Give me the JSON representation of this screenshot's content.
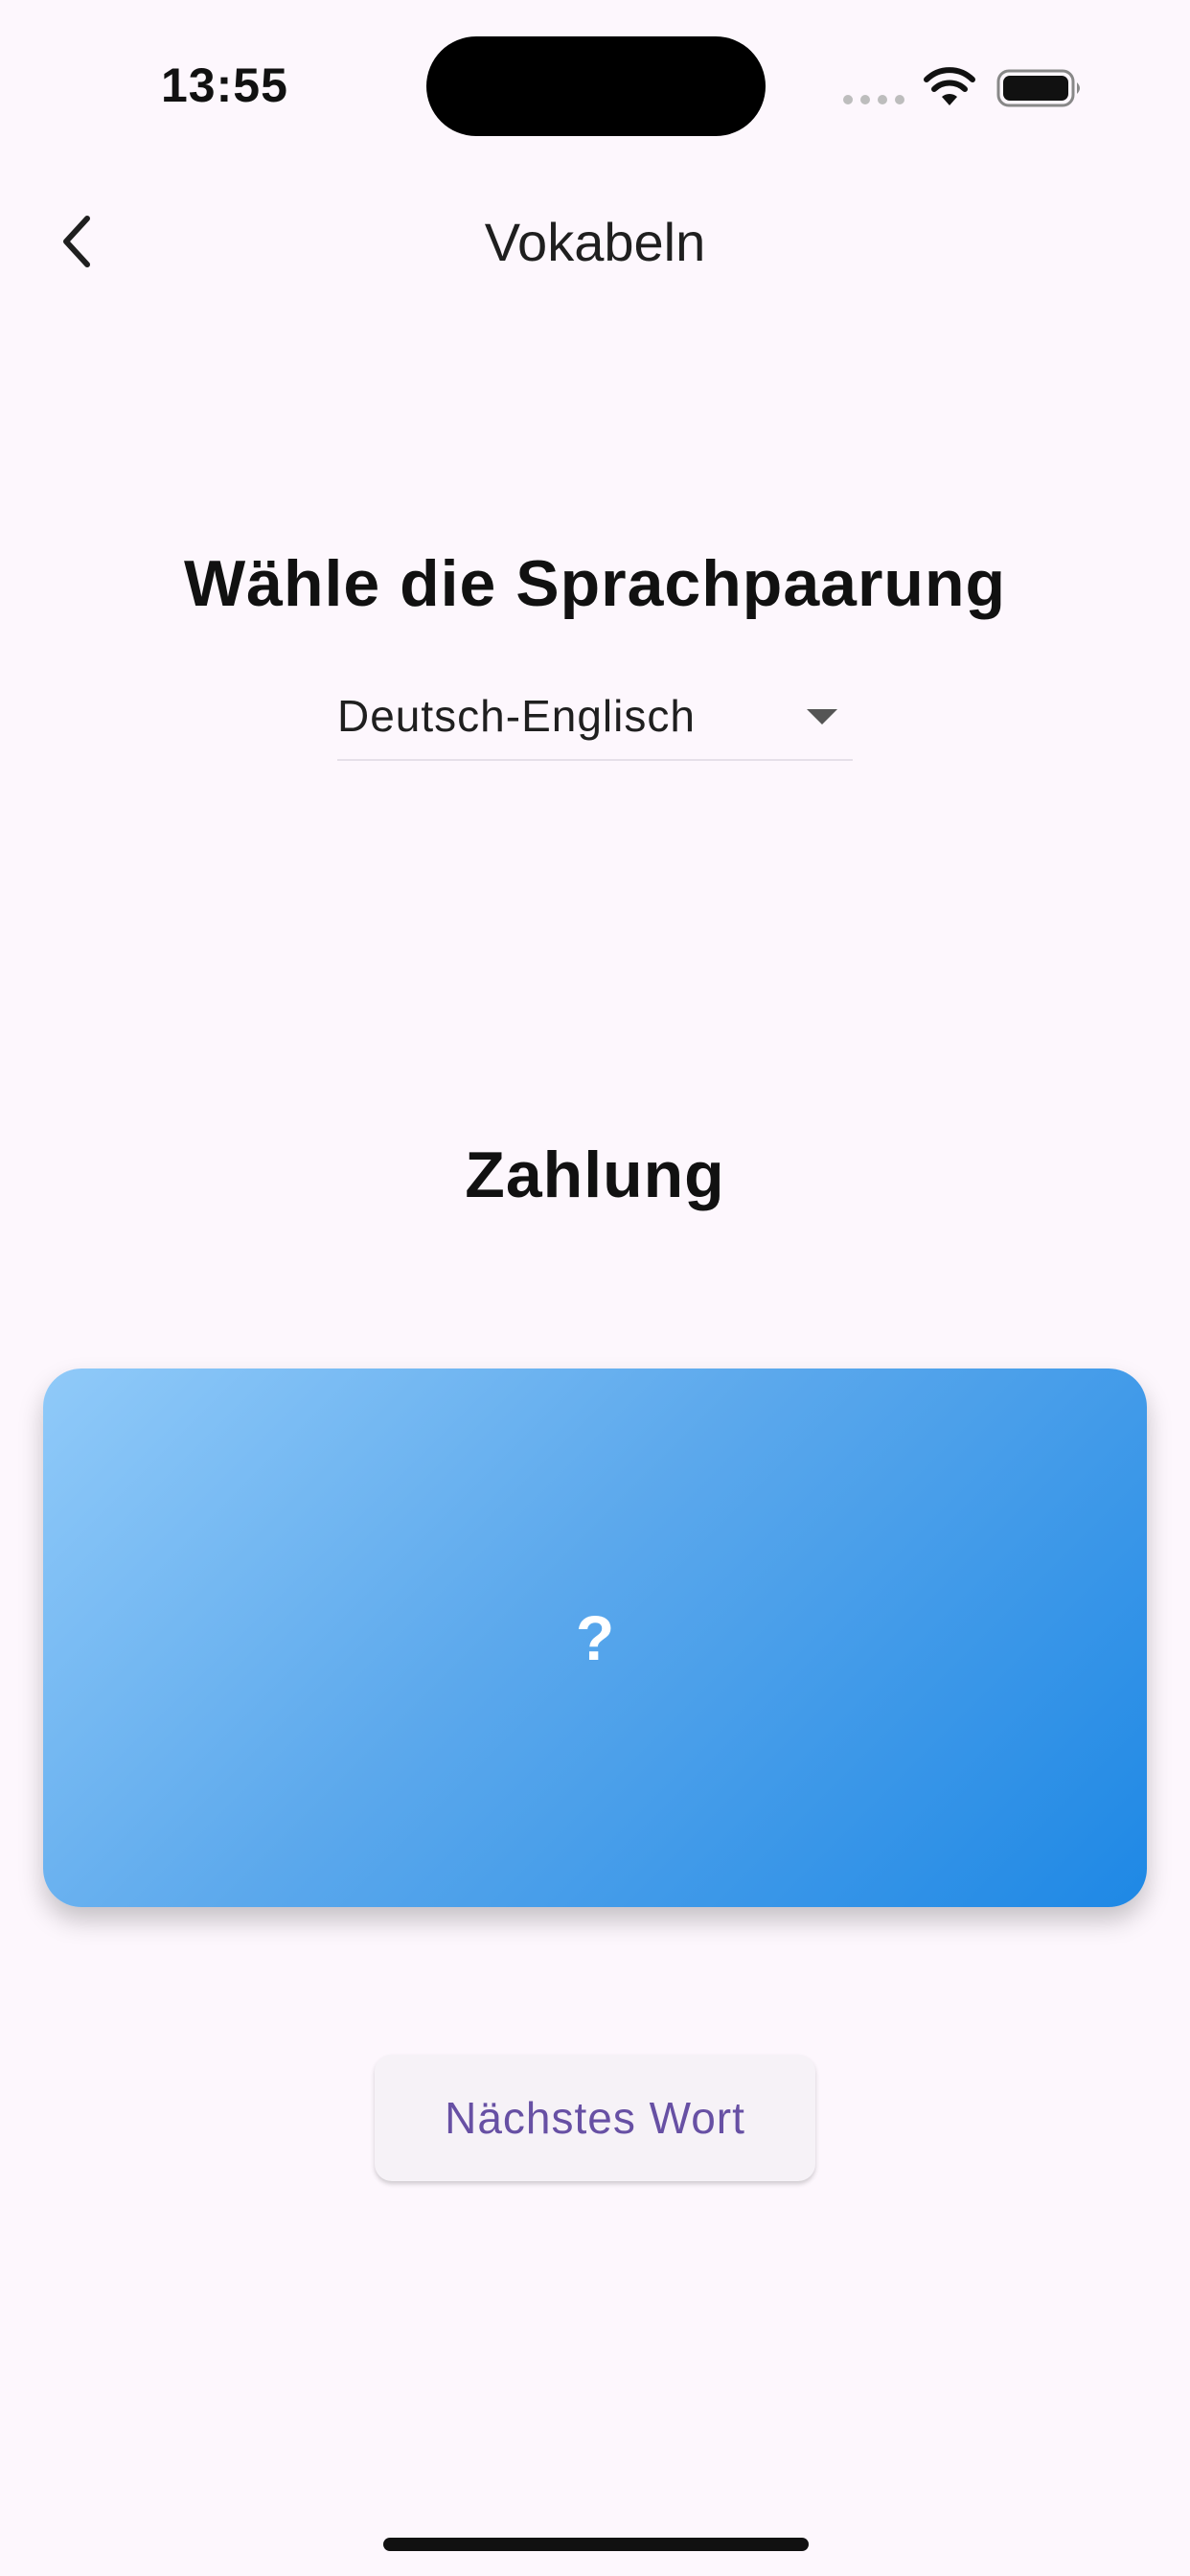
{
  "status_bar": {
    "time": "13:55"
  },
  "nav": {
    "title": "Vokabeln",
    "back_icon": "chevron-left-icon"
  },
  "main": {
    "pairing_heading": "Wähle die Sprachpaarung",
    "pairing_dropdown": {
      "selected": "Deutsch-Englisch"
    },
    "current_word": "Zahlung",
    "flashcard": {
      "text": "?",
      "gradient_start": "#90CAF9",
      "gradient_end": "#1E88E5"
    },
    "next_button_label": "Nächstes Wort"
  },
  "colors": {
    "background": "#FDF7FD",
    "accent": "#6750A4"
  }
}
